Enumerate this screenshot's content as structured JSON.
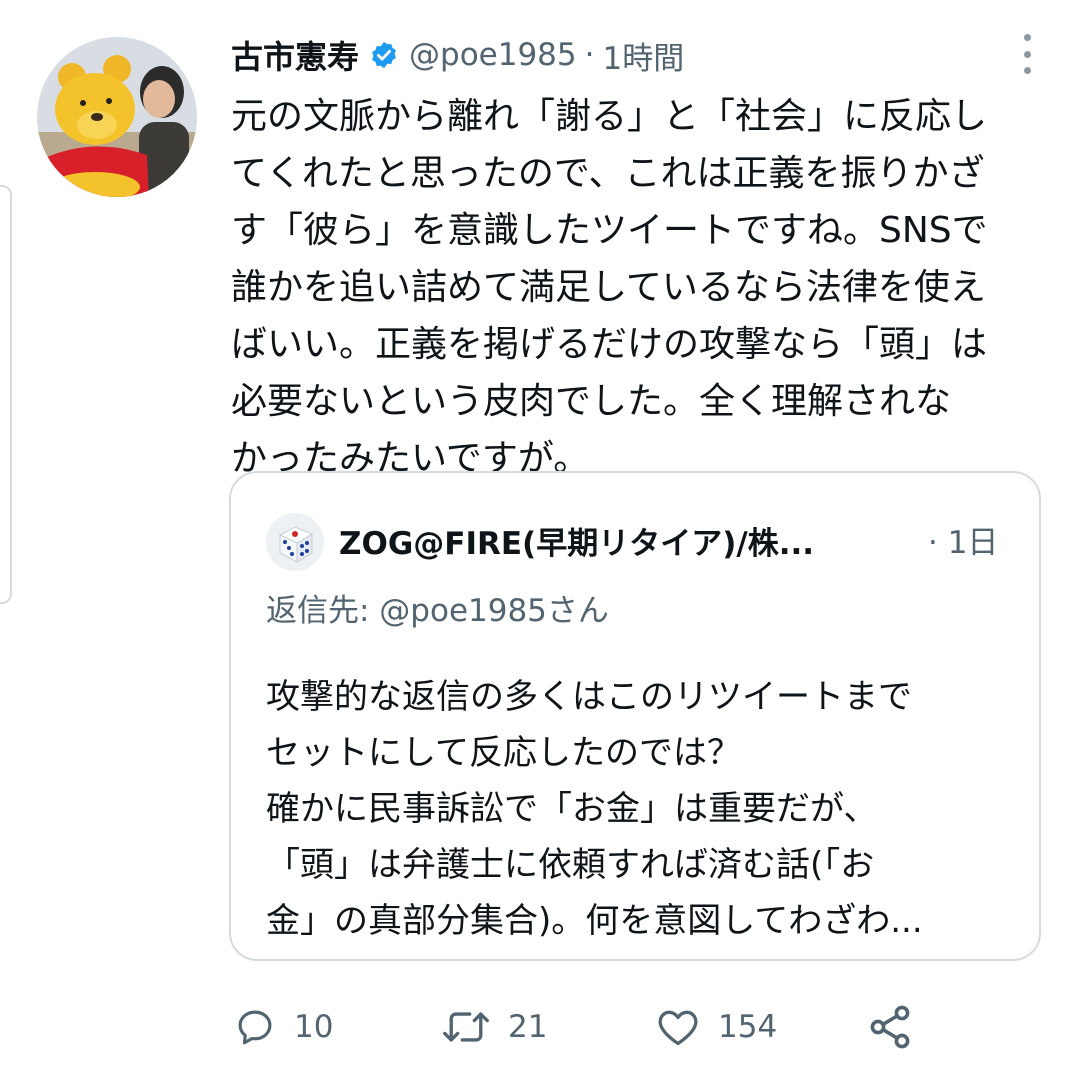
{
  "tweet": {
    "author_name": "古市憲寿",
    "verified": true,
    "handle": "@poe1985",
    "separator": "·",
    "time": "1時間",
    "text": "元の文脈から離れ「謝る」と「社会」に反応し\nてくれたと思ったので、これは正義を振りかざ\nす「彼ら」を意識したツイートですね。SNSで\n誰かを追い詰めて満足しているなら法律を使え\nばいい。正義を掲げるだけの攻撃なら「頭」は\n必要ないという皮肉でした。全く理解されな\nかったみたいですが。"
  },
  "quoted_tweet": {
    "author_name": "ZOG@FIRE(早期リタイア)/株...",
    "time": "· 1日",
    "reply_to": "返信先: @poe1985さん",
    "text": "攻撃的な返信の多くはこのリツイートまで\nセットにして反応したのでは？\n確かに民事訴訟で「お金」は重要だが、\n「頭」は弁護士に依頼すれば済む話(「お\n金」の真部分集合)。何を意図してわざわ..."
  },
  "actions": {
    "replies": "10",
    "retweets": "21",
    "likes": "154"
  },
  "colors": {
    "verified": "#1d9bf0",
    "secondary_text": "#536471",
    "border": "#d6dbe0",
    "icon": "#536471"
  },
  "icons": [
    "verified-badge-icon",
    "more-options-icon",
    "reply-icon",
    "retweet-icon",
    "like-icon",
    "share-icon"
  ]
}
